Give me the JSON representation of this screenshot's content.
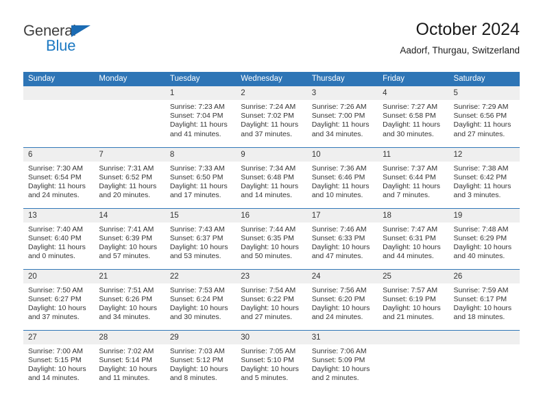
{
  "branding": {
    "logo_text_top": "General",
    "logo_text_bottom": "Blue",
    "logo_color_dark": "#404040",
    "logo_color_blue": "#1b78c2",
    "triangle_color": "#1b6bb3"
  },
  "header": {
    "title": "October 2024",
    "subtitle": "Aadorf, Thurgau, Switzerland"
  },
  "theme": {
    "header_blue": "#2e75b6",
    "daynum_band": "#efefef",
    "text": "#333333"
  },
  "weekdays": [
    "Sunday",
    "Monday",
    "Tuesday",
    "Wednesday",
    "Thursday",
    "Friday",
    "Saturday"
  ],
  "labels": {
    "sunrise_prefix": "Sunrise:",
    "sunset_prefix": "Sunset:",
    "daylight_prefix": "Daylight:"
  },
  "weeks": [
    [
      {
        "day": ""
      },
      {
        "day": ""
      },
      {
        "day": "1",
        "sunrise": "Sunrise: 7:23 AM",
        "sunset": "Sunset: 7:04 PM",
        "daylight_l1": "Daylight: 11 hours",
        "daylight_l2": "and 41 minutes."
      },
      {
        "day": "2",
        "sunrise": "Sunrise: 7:24 AM",
        "sunset": "Sunset: 7:02 PM",
        "daylight_l1": "Daylight: 11 hours",
        "daylight_l2": "and 37 minutes."
      },
      {
        "day": "3",
        "sunrise": "Sunrise: 7:26 AM",
        "sunset": "Sunset: 7:00 PM",
        "daylight_l1": "Daylight: 11 hours",
        "daylight_l2": "and 34 minutes."
      },
      {
        "day": "4",
        "sunrise": "Sunrise: 7:27 AM",
        "sunset": "Sunset: 6:58 PM",
        "daylight_l1": "Daylight: 11 hours",
        "daylight_l2": "and 30 minutes."
      },
      {
        "day": "5",
        "sunrise": "Sunrise: 7:29 AM",
        "sunset": "Sunset: 6:56 PM",
        "daylight_l1": "Daylight: 11 hours",
        "daylight_l2": "and 27 minutes."
      }
    ],
    [
      {
        "day": "6",
        "sunrise": "Sunrise: 7:30 AM",
        "sunset": "Sunset: 6:54 PM",
        "daylight_l1": "Daylight: 11 hours",
        "daylight_l2": "and 24 minutes."
      },
      {
        "day": "7",
        "sunrise": "Sunrise: 7:31 AM",
        "sunset": "Sunset: 6:52 PM",
        "daylight_l1": "Daylight: 11 hours",
        "daylight_l2": "and 20 minutes."
      },
      {
        "day": "8",
        "sunrise": "Sunrise: 7:33 AM",
        "sunset": "Sunset: 6:50 PM",
        "daylight_l1": "Daylight: 11 hours",
        "daylight_l2": "and 17 minutes."
      },
      {
        "day": "9",
        "sunrise": "Sunrise: 7:34 AM",
        "sunset": "Sunset: 6:48 PM",
        "daylight_l1": "Daylight: 11 hours",
        "daylight_l2": "and 14 minutes."
      },
      {
        "day": "10",
        "sunrise": "Sunrise: 7:36 AM",
        "sunset": "Sunset: 6:46 PM",
        "daylight_l1": "Daylight: 11 hours",
        "daylight_l2": "and 10 minutes."
      },
      {
        "day": "11",
        "sunrise": "Sunrise: 7:37 AM",
        "sunset": "Sunset: 6:44 PM",
        "daylight_l1": "Daylight: 11 hours",
        "daylight_l2": "and 7 minutes."
      },
      {
        "day": "12",
        "sunrise": "Sunrise: 7:38 AM",
        "sunset": "Sunset: 6:42 PM",
        "daylight_l1": "Daylight: 11 hours",
        "daylight_l2": "and 3 minutes."
      }
    ],
    [
      {
        "day": "13",
        "sunrise": "Sunrise: 7:40 AM",
        "sunset": "Sunset: 6:40 PM",
        "daylight_l1": "Daylight: 11 hours",
        "daylight_l2": "and 0 minutes."
      },
      {
        "day": "14",
        "sunrise": "Sunrise: 7:41 AM",
        "sunset": "Sunset: 6:39 PM",
        "daylight_l1": "Daylight: 10 hours",
        "daylight_l2": "and 57 minutes."
      },
      {
        "day": "15",
        "sunrise": "Sunrise: 7:43 AM",
        "sunset": "Sunset: 6:37 PM",
        "daylight_l1": "Daylight: 10 hours",
        "daylight_l2": "and 53 minutes."
      },
      {
        "day": "16",
        "sunrise": "Sunrise: 7:44 AM",
        "sunset": "Sunset: 6:35 PM",
        "daylight_l1": "Daylight: 10 hours",
        "daylight_l2": "and 50 minutes."
      },
      {
        "day": "17",
        "sunrise": "Sunrise: 7:46 AM",
        "sunset": "Sunset: 6:33 PM",
        "daylight_l1": "Daylight: 10 hours",
        "daylight_l2": "and 47 minutes."
      },
      {
        "day": "18",
        "sunrise": "Sunrise: 7:47 AM",
        "sunset": "Sunset: 6:31 PM",
        "daylight_l1": "Daylight: 10 hours",
        "daylight_l2": "and 44 minutes."
      },
      {
        "day": "19",
        "sunrise": "Sunrise: 7:48 AM",
        "sunset": "Sunset: 6:29 PM",
        "daylight_l1": "Daylight: 10 hours",
        "daylight_l2": "and 40 minutes."
      }
    ],
    [
      {
        "day": "20",
        "sunrise": "Sunrise: 7:50 AM",
        "sunset": "Sunset: 6:27 PM",
        "daylight_l1": "Daylight: 10 hours",
        "daylight_l2": "and 37 minutes."
      },
      {
        "day": "21",
        "sunrise": "Sunrise: 7:51 AM",
        "sunset": "Sunset: 6:26 PM",
        "daylight_l1": "Daylight: 10 hours",
        "daylight_l2": "and 34 minutes."
      },
      {
        "day": "22",
        "sunrise": "Sunrise: 7:53 AM",
        "sunset": "Sunset: 6:24 PM",
        "daylight_l1": "Daylight: 10 hours",
        "daylight_l2": "and 30 minutes."
      },
      {
        "day": "23",
        "sunrise": "Sunrise: 7:54 AM",
        "sunset": "Sunset: 6:22 PM",
        "daylight_l1": "Daylight: 10 hours",
        "daylight_l2": "and 27 minutes."
      },
      {
        "day": "24",
        "sunrise": "Sunrise: 7:56 AM",
        "sunset": "Sunset: 6:20 PM",
        "daylight_l1": "Daylight: 10 hours",
        "daylight_l2": "and 24 minutes."
      },
      {
        "day": "25",
        "sunrise": "Sunrise: 7:57 AM",
        "sunset": "Sunset: 6:19 PM",
        "daylight_l1": "Daylight: 10 hours",
        "daylight_l2": "and 21 minutes."
      },
      {
        "day": "26",
        "sunrise": "Sunrise: 7:59 AM",
        "sunset": "Sunset: 6:17 PM",
        "daylight_l1": "Daylight: 10 hours",
        "daylight_l2": "and 18 minutes."
      }
    ],
    [
      {
        "day": "27",
        "sunrise": "Sunrise: 7:00 AM",
        "sunset": "Sunset: 5:15 PM",
        "daylight_l1": "Daylight: 10 hours",
        "daylight_l2": "and 14 minutes."
      },
      {
        "day": "28",
        "sunrise": "Sunrise: 7:02 AM",
        "sunset": "Sunset: 5:14 PM",
        "daylight_l1": "Daylight: 10 hours",
        "daylight_l2": "and 11 minutes."
      },
      {
        "day": "29",
        "sunrise": "Sunrise: 7:03 AM",
        "sunset": "Sunset: 5:12 PM",
        "daylight_l1": "Daylight: 10 hours",
        "daylight_l2": "and 8 minutes."
      },
      {
        "day": "30",
        "sunrise": "Sunrise: 7:05 AM",
        "sunset": "Sunset: 5:10 PM",
        "daylight_l1": "Daylight: 10 hours",
        "daylight_l2": "and 5 minutes."
      },
      {
        "day": "31",
        "sunrise": "Sunrise: 7:06 AM",
        "sunset": "Sunset: 5:09 PM",
        "daylight_l1": "Daylight: 10 hours",
        "daylight_l2": "and 2 minutes."
      },
      {
        "day": ""
      },
      {
        "day": ""
      }
    ]
  ]
}
